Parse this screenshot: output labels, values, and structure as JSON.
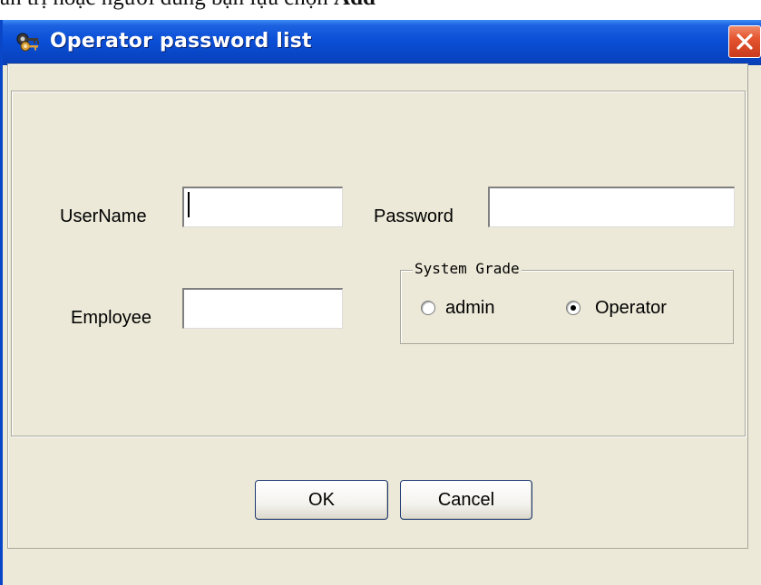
{
  "background_text": {
    "prefix": "ản trị hoặc người dùng bạn lựa chọn ",
    "bold": "Add"
  },
  "window": {
    "title": "Operator password list",
    "title_icon": "keys-icon",
    "close_icon": "close-icon",
    "titlebar_color": "#0a4fd6",
    "close_color": "#e4542f",
    "body_color": "#ece9d8"
  },
  "form": {
    "username_label": "UserName",
    "username_value": "",
    "password_label": "Password",
    "password_value": "",
    "employee_label": "Employee",
    "employee_value": ""
  },
  "system_grade": {
    "legend": "System Grade",
    "options": [
      {
        "label": "admin",
        "selected": false
      },
      {
        "label": "Operator",
        "selected": true
      }
    ]
  },
  "buttons": {
    "ok": "OK",
    "cancel": "Cancel"
  }
}
